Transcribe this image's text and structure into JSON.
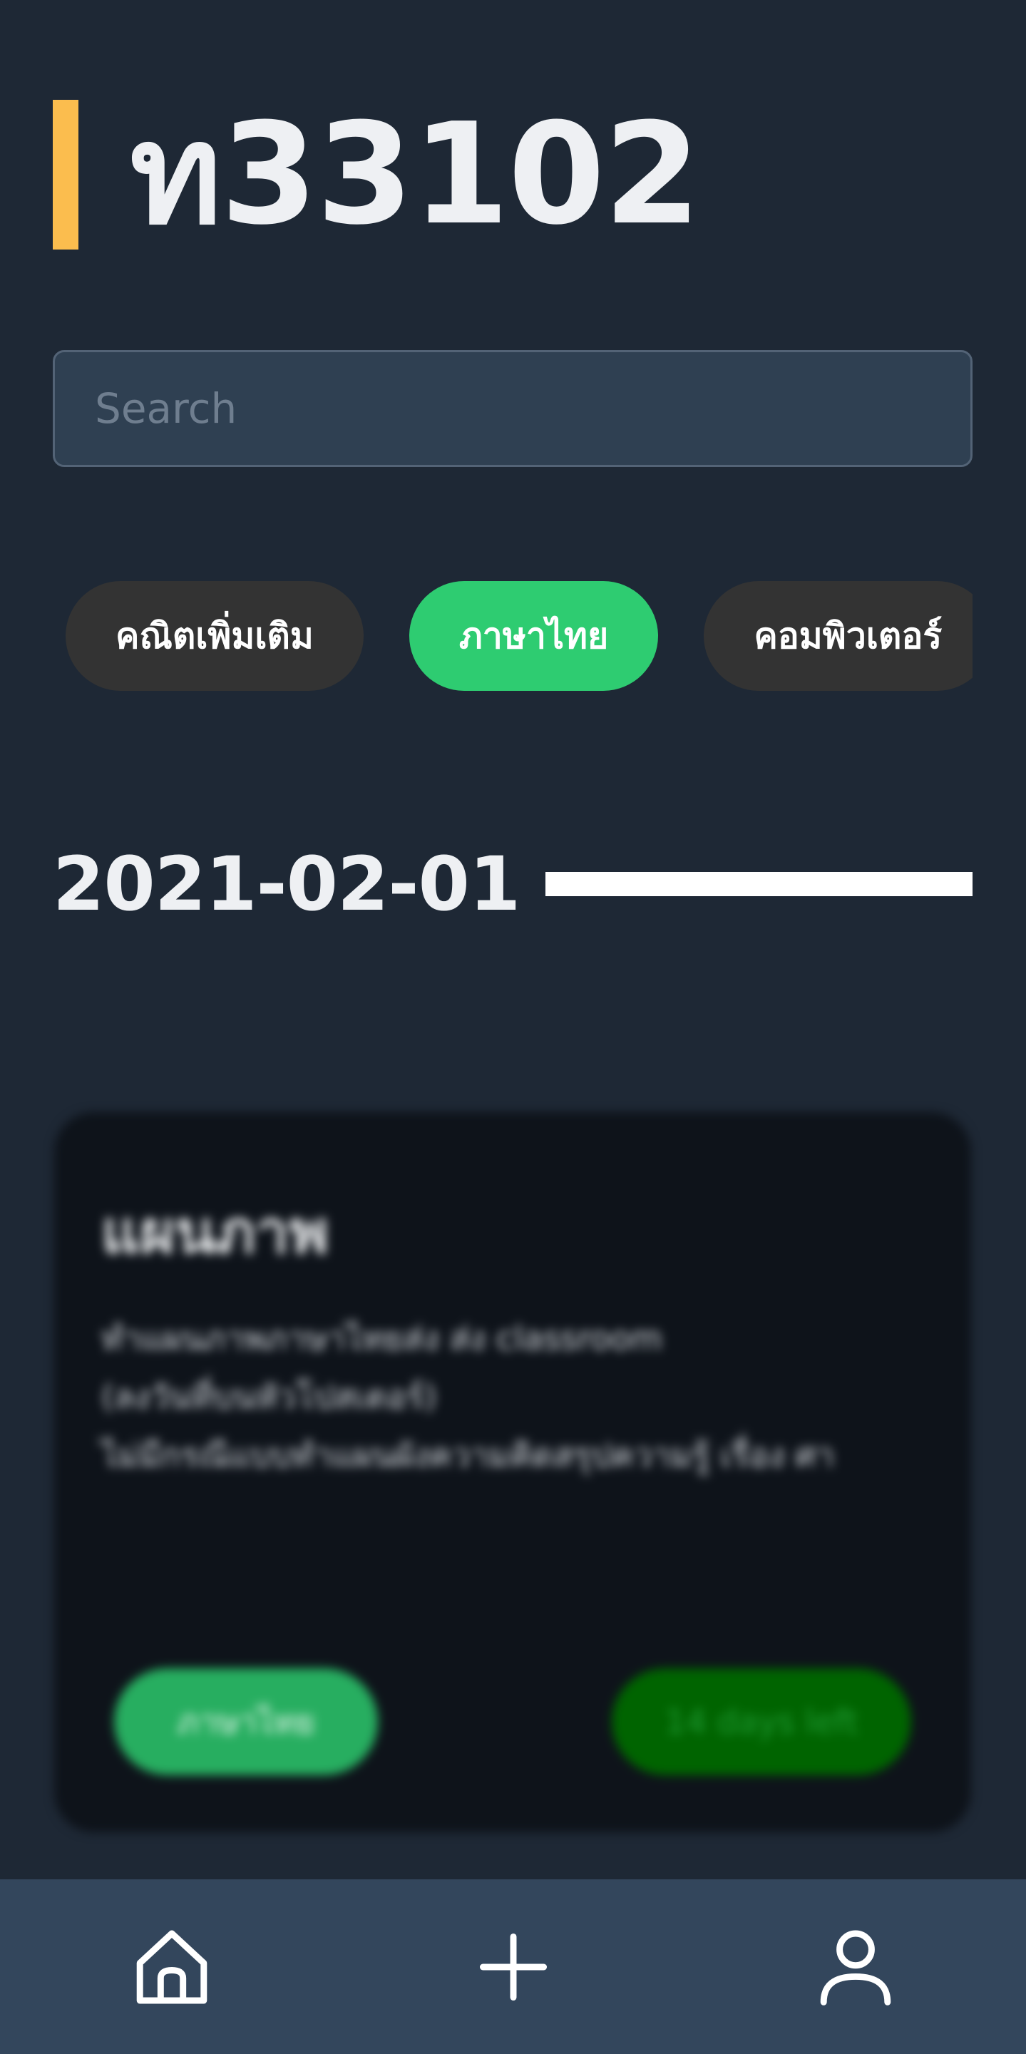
{
  "header": {
    "title": "ท33102",
    "accent_color": "#fbbd4e"
  },
  "search": {
    "placeholder": "Search",
    "value": ""
  },
  "categories": [
    {
      "label": "คณิตเพิ่มเติม",
      "active": false
    },
    {
      "label": "ภาษาไทย",
      "active": true
    },
    {
      "label": "คอมพิวเตอร์",
      "active": false
    }
  ],
  "section": {
    "date": "2021-02-01"
  },
  "card": {
    "title": "แผนภาพ",
    "description_lines": [
      "ทำแผนภาพภาษาไทยส่ง ส่ง classroom",
      "(ลงวันที่บนหัวโปสเตอร์)",
      "ไม่มีกรณีแบบทำแผนผังความคิดสรุปความรู้ เรื่อง ศา"
    ],
    "tag": "ภาษาไทย",
    "due": "14 days left"
  },
  "nav": {
    "home_icon": "home-icon",
    "add_icon": "plus-icon",
    "profile_icon": "user-icon"
  },
  "colors": {
    "background": "#1e2835",
    "chip_active": "#2ecc71",
    "chip_inactive": "#333333",
    "nav_bar": "#33465c"
  }
}
